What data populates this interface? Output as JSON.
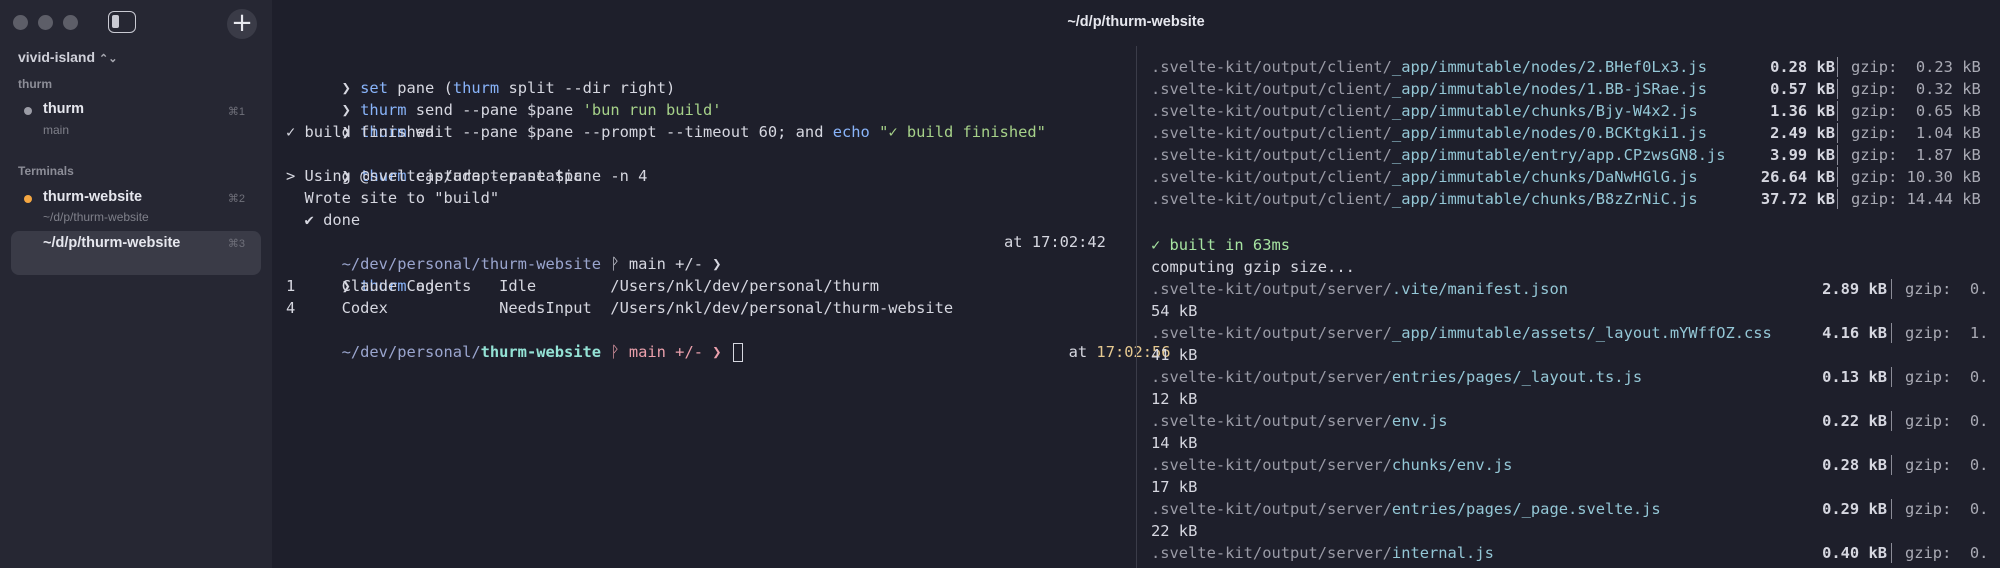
{
  "window": {
    "title": "~/d/p/thurm-website"
  },
  "sidebar": {
    "workspace": "vivid-island",
    "groups": [
      {
        "label": "thurm"
      },
      {
        "label": "Terminals"
      }
    ],
    "items": [
      {
        "title": "thurm",
        "sub": "main",
        "kbd": "⌘1",
        "bullet": "#9b9ca6"
      },
      {
        "title": "thurm-website",
        "sub": "~/d/p/thurm-website",
        "kbd": "⌘2",
        "bullet": "#f5a742"
      },
      {
        "title": "~/d/p/thurm-website",
        "sub": "",
        "kbd": "⌘3",
        "bullet": ""
      }
    ]
  },
  "left_terminal": {
    "cmd1": [
      "❯ ",
      "set",
      " pane (",
      "thurm",
      " split --dir right)"
    ],
    "cmd2": [
      "❯ ",
      "thurm",
      " send --pane $pane ",
      "'bun run build'"
    ],
    "cmd3": [
      "❯ ",
      "thurm",
      " wait --pane $pane --prompt --timeout 60; and ",
      "echo",
      " ",
      "\"✓ build finished\""
    ],
    "out1": "✓ build finished",
    "cmd4": [
      "❯ ",
      "thurm",
      " capture --pane $pane -n 4"
    ],
    "out2": "> Using @sveltejs/adapter-static",
    "out3": "  Wrote site to \"build\"",
    "out4": "  ✔ done",
    "prompt1": [
      "~/dev/personal/thurm-website",
      " ᚹ main +/- ❯"
    ],
    "prompt1_time": "at 17:02:42",
    "cmd5": [
      "❯ ",
      "thurm",
      " agents"
    ],
    "agents": [
      "1     Claude Code      Idle        /Users/nkl/dev/personal/thurm",
      "4     Codex            NeedsInput  /Users/nkl/dev/personal/thurm-website"
    ],
    "prompt2": [
      "~/dev/personal/",
      "thurm-website",
      " ᚹ main +/- ❯ "
    ],
    "prompt2_at": "at ",
    "prompt2_time": "17:02:56"
  },
  "right_terminal": {
    "client_files": [
      {
        "prefix": ".svelte-kit/output/client/",
        "name": "_app/immutable/nodes/2.BHef0Lx3.js",
        "size": "0.28 kB",
        "gzip": "gzip:  0.23 kB"
      },
      {
        "prefix": ".svelte-kit/output/client/",
        "name": "_app/immutable/nodes/1.BB-jSRae.js",
        "size": "0.57 kB",
        "gzip": "gzip:  0.32 kB"
      },
      {
        "prefix": ".svelte-kit/output/client/",
        "name": "_app/immutable/chunks/Bjy-W4x2.js",
        "size": "1.36 kB",
        "gzip": "gzip:  0.65 kB"
      },
      {
        "prefix": ".svelte-kit/output/client/",
        "name": "_app/immutable/nodes/0.BCKtgki1.js",
        "size": "2.49 kB",
        "gzip": "gzip:  1.04 kB"
      },
      {
        "prefix": ".svelte-kit/output/client/",
        "name": "_app/immutable/entry/app.CPzwsGN8.js",
        "size": "3.99 kB",
        "gzip": "gzip:  1.87 kB"
      },
      {
        "prefix": ".svelte-kit/output/client/",
        "name": "_app/immutable/chunks/DaNwHGlG.js",
        "size": "26.64 kB",
        "gzip": "gzip: 10.30 kB"
      },
      {
        "prefix": ".svelte-kit/output/client/",
        "name": "_app/immutable/chunks/B8zZrNiC.js",
        "size": "37.72 kB",
        "gzip": "gzip: 14.44 kB"
      }
    ],
    "built": "✓ built in 63ms",
    "computing": "computing gzip size...",
    "server_files": [
      {
        "prefix": ".svelte-kit/output/server/",
        "name": ".vite/manifest.json",
        "size": "2.89 kB",
        "gzip": "gzip:  0.",
        "wrap": "54 kB"
      },
      {
        "prefix": ".svelte-kit/output/server/",
        "name": "_app/immutable/assets/_layout.mYWffOZ.css",
        "size": "4.16 kB",
        "gzip": "gzip:  1.",
        "wrap": "41 kB"
      },
      {
        "prefix": ".svelte-kit/output/server/",
        "name": "entries/pages/_layout.ts.js",
        "size": "0.13 kB",
        "gzip": "gzip:  0.",
        "wrap": "12 kB"
      },
      {
        "prefix": ".svelte-kit/output/server/",
        "name": "env.js",
        "size": "0.22 kB",
        "gzip": "gzip:  0.",
        "wrap": "14 kB"
      },
      {
        "prefix": ".svelte-kit/output/server/",
        "name": "chunks/env.js",
        "size": "0.28 kB",
        "gzip": "gzip:  0.",
        "wrap": "17 kB"
      },
      {
        "prefix": ".svelte-kit/output/server/",
        "name": "entries/pages/_page.svelte.js",
        "size": "0.29 kB",
        "gzip": "gzip:  0.",
        "wrap": "22 kB"
      },
      {
        "prefix": ".svelte-kit/output/server/",
        "name": "internal.js",
        "size": "0.40 kB",
        "gzip": "gzip:  0.",
        "wrap": ""
      }
    ]
  }
}
